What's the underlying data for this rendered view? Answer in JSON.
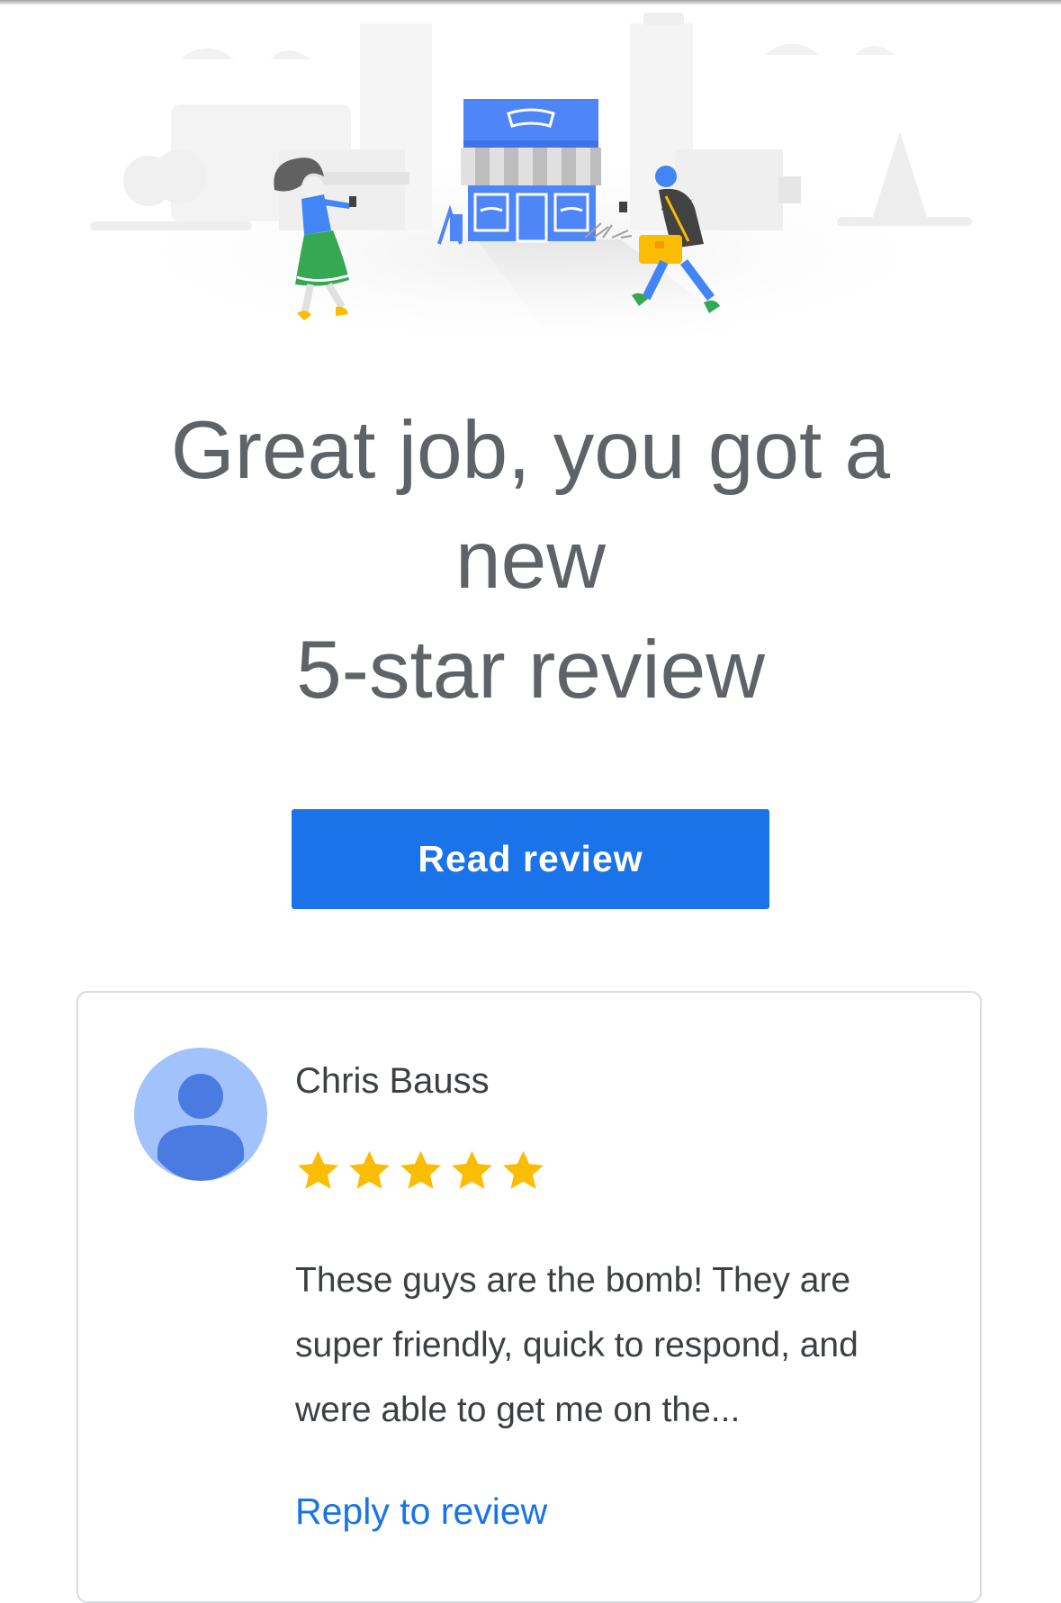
{
  "hero": {
    "illustration": "storefront-with-pedestrians-illustration"
  },
  "headline": {
    "line1": "Great job, you got a",
    "line2": "new",
    "line3": "5-star review"
  },
  "cta": {
    "label": "Read review"
  },
  "review": {
    "reviewer_name": "Chris Bauss",
    "avatar_icon": "person-icon",
    "rating": 5,
    "rating_max": 5,
    "text": "These guys are the bomb! They are super friendly, quick to respond, and were able to get me on the...",
    "reply_label": "Reply to review"
  },
  "colors": {
    "primary_blue": "#1a73e8",
    "headline_gray": "#5f6368",
    "star_gold": "#fbbc04",
    "avatar_bg": "#a1c2fa",
    "avatar_fg": "#4a7be0",
    "card_border": "#dadce0"
  }
}
